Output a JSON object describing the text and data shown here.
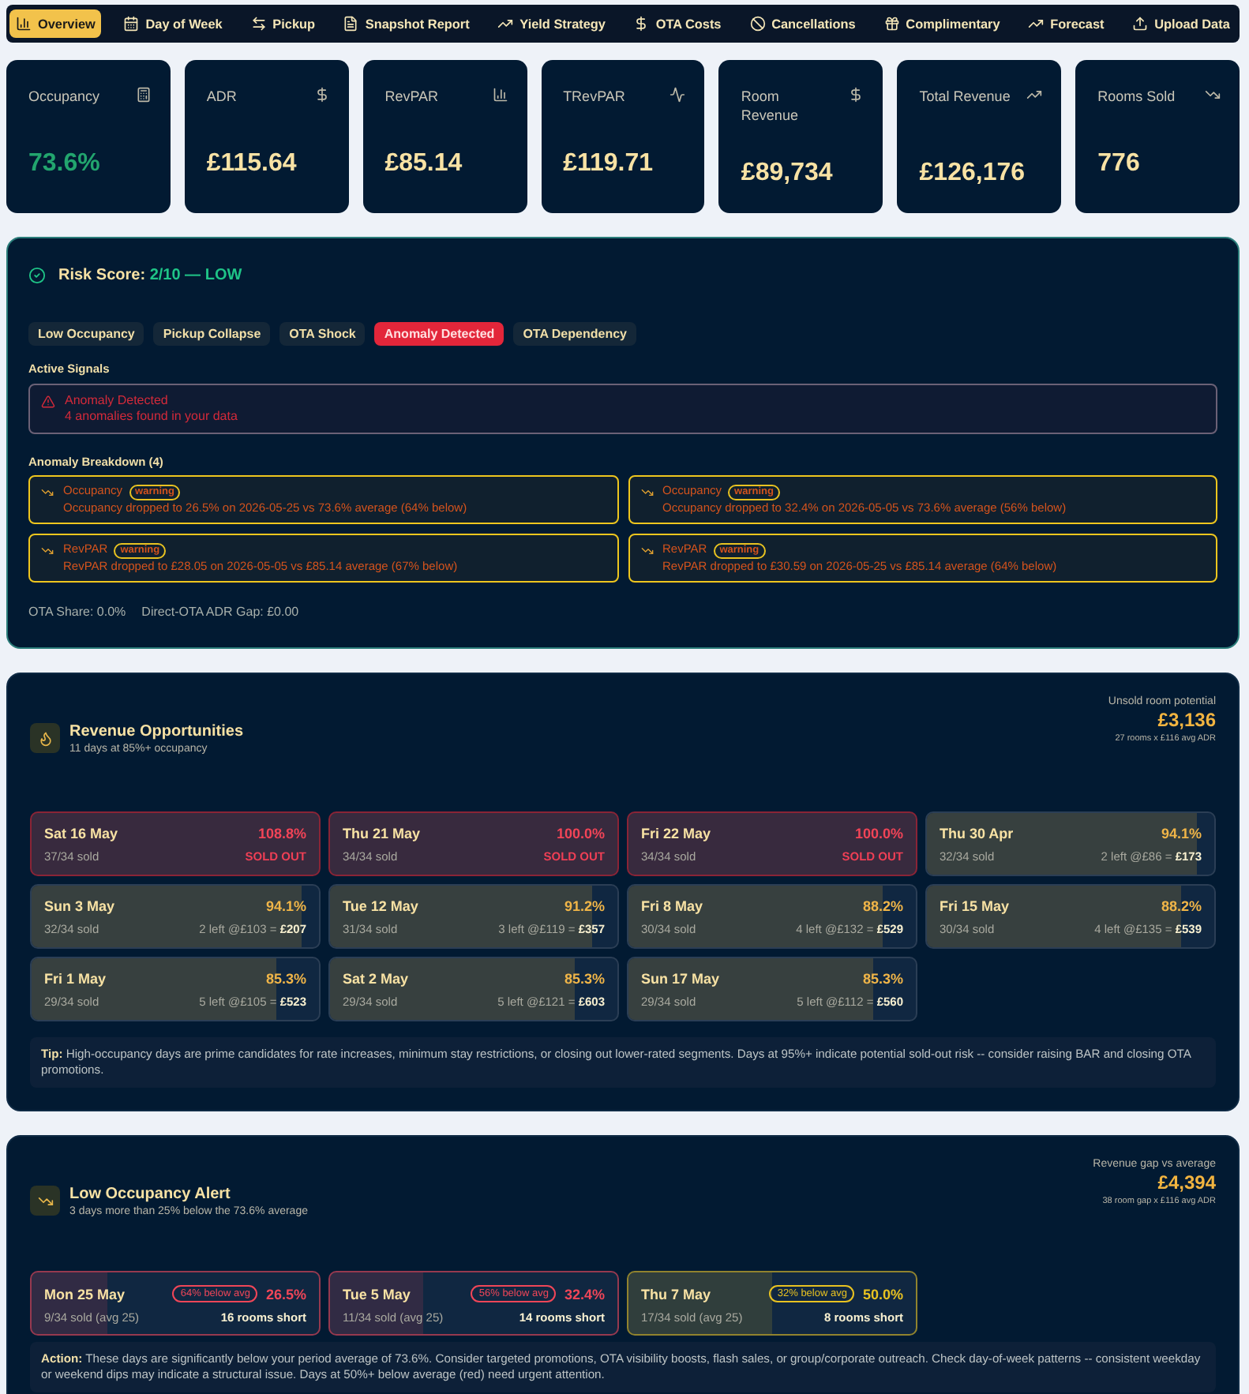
{
  "nav": [
    {
      "label": "Overview",
      "selected": true
    },
    {
      "label": "Day of Week",
      "selected": false
    },
    {
      "label": "Pickup",
      "selected": false
    },
    {
      "label": "Snapshot Report",
      "selected": false
    },
    {
      "label": "Yield Strategy",
      "selected": false
    },
    {
      "label": "OTA Costs",
      "selected": false
    },
    {
      "label": "Cancellations",
      "selected": false
    },
    {
      "label": "Complimentary",
      "selected": false
    },
    {
      "label": "Forecast",
      "selected": false
    },
    {
      "label": "Upload Data",
      "selected": false
    }
  ],
  "kpis": [
    {
      "label": "Occupancy",
      "value": "73.6%",
      "color": "#22a56e"
    },
    {
      "label": "ADR",
      "value": "£115.64",
      "color": "#f8e2a4"
    },
    {
      "label": "RevPAR",
      "value": "£85.14",
      "color": "#f8e2a4"
    },
    {
      "label": "TRevPAR",
      "value": "£119.71",
      "color": "#f8e2a4"
    },
    {
      "label": "Room Revenue",
      "value": "£89,734",
      "color": "#f8e2a4"
    },
    {
      "label": "Total Revenue",
      "value": "£126,176",
      "color": "#f8e2a4"
    },
    {
      "label": "Rooms Sold",
      "value": "776",
      "color": "#f8e2a4"
    }
  ],
  "risk": {
    "title": "Risk Score:",
    "score": "2/10 — LOW",
    "signals": [
      {
        "label": "Low Occupancy",
        "active": false
      },
      {
        "label": "Pickup Collapse",
        "active": false
      },
      {
        "label": "OTA Shock",
        "active": false
      },
      {
        "label": "Anomaly Detected",
        "active": true
      },
      {
        "label": "OTA Dependency",
        "active": false
      }
    ],
    "active_heading": "Active Signals",
    "alert": {
      "title": "Anomaly Detected",
      "message": "4 anomalies found in your data"
    },
    "breakdown_heading": "Anomaly Breakdown (4)",
    "anomalies": [
      {
        "metric": "Occupancy",
        "badge": "warning",
        "message": "Occupancy dropped to 26.5% on 2026-05-25 vs 73.6% average (64% below)"
      },
      {
        "metric": "Occupancy",
        "badge": "warning",
        "message": "Occupancy dropped to 32.4% on 2026-05-05 vs 73.6% average (56% below)"
      },
      {
        "metric": "RevPAR",
        "badge": "warning",
        "message": "RevPAR dropped to £28.05 on 2026-05-05 vs £85.14 average (67% below)"
      },
      {
        "metric": "RevPAR",
        "badge": "warning",
        "message": "RevPAR dropped to £30.59 on 2026-05-25 vs £85.14 average (64% below)"
      }
    ],
    "footer": [
      "OTA Share: 0.0%",
      "Direct-OTA ADR Gap: £0.00"
    ]
  },
  "opportunities": {
    "title": "Revenue Opportunities",
    "subtitle": "11 days at 85%+ occupancy",
    "potential_label": "Unsold room potential",
    "potential_value": "£3,136",
    "potential_note": "27 rooms x £116 avg ADR",
    "days": [
      {
        "date": "Sat 16 May",
        "pct": "108.8%",
        "sold": "37/34 sold",
        "kind": "sold_out",
        "note": "SOLD OUT"
      },
      {
        "date": "Thu 21 May",
        "pct": "100.0%",
        "sold": "34/34 sold",
        "kind": "sold_out",
        "note": "SOLD OUT"
      },
      {
        "date": "Fri 22 May",
        "pct": "100.0%",
        "sold": "34/34 sold",
        "kind": "sold_out",
        "note": "SOLD OUT"
      },
      {
        "date": "Thu 30 Apr",
        "pct": "94.1%",
        "sold": "32/34 sold",
        "kind": "open",
        "level": 0.941,
        "note": "2 left @£86 =",
        "amount": "£173"
      },
      {
        "date": "Sun 3 May",
        "pct": "94.1%",
        "sold": "32/34 sold",
        "kind": "open",
        "level": 0.941,
        "note": "2 left @£103 =",
        "amount": "£207"
      },
      {
        "date": "Tue 12 May",
        "pct": "91.2%",
        "sold": "31/34 sold",
        "kind": "open",
        "level": 0.912,
        "note": "3 left @£119 =",
        "amount": "£357"
      },
      {
        "date": "Fri 8 May",
        "pct": "88.2%",
        "sold": "30/34 sold",
        "kind": "open",
        "level": 0.882,
        "note": "4 left @£132 =",
        "amount": "£529"
      },
      {
        "date": "Fri 15 May",
        "pct": "88.2%",
        "sold": "30/34 sold",
        "kind": "open",
        "level": 0.882,
        "note": "4 left @£135 =",
        "amount": "£539"
      },
      {
        "date": "Fri 1 May",
        "pct": "85.3%",
        "sold": "29/34 sold",
        "kind": "open",
        "level": 0.853,
        "note": "5 left @£105 =",
        "amount": "£523"
      },
      {
        "date": "Sat 2 May",
        "pct": "85.3%",
        "sold": "29/34 sold",
        "kind": "open",
        "level": 0.853,
        "note": "5 left @£121 =",
        "amount": "£603"
      },
      {
        "date": "Sun 17 May",
        "pct": "85.3%",
        "sold": "29/34 sold",
        "kind": "open",
        "level": 0.853,
        "note": "5 left @£112 =",
        "amount": "£560"
      }
    ],
    "tip": "**Tip:** High-occupancy days are prime candidates for rate increases, minimum stay restrictions, or closing out lower-rated segments. Days at 95%+ indicate potential sold-out risk -- consider raising BAR and closing OTA promotions."
  },
  "low_occupancy": {
    "title": "Low Occupancy Alert",
    "subtitle": "3 days more than 25% below the 73.6% average",
    "gap_label": "Revenue gap vs average",
    "gap_value": "£4,394",
    "gap_note": "38 room gap x £116 avg ADR",
    "days": [
      {
        "date": "Mon 25 May",
        "badge": "64% below avg",
        "pct": "26.5%",
        "sold": "9/34 sold (avg 25)",
        "short": "16 rooms short",
        "color": "#f04658",
        "level": 0.265
      },
      {
        "date": "Tue 5 May",
        "badge": "56% below avg",
        "pct": "32.4%",
        "sold": "11/34 sold (avg 25)",
        "short": "14 rooms short",
        "color": "#f04658",
        "level": 0.324
      },
      {
        "date": "Thu 7 May",
        "badge": "32% below avg",
        "pct": "50.0%",
        "sold": "17/34 sold (avg 25)",
        "short": "8 rooms short",
        "color": "#e8c221",
        "level": 0.5
      }
    ],
    "action": "**Action:** These days are significantly below your period average of 73.6%. Consider targeted promotions, OTA visibility boosts, flash sales, or group/corporate outreach. Check day-of-week patterns -- consistent weekday or weekend dips may indicate a structural issue. Days at 50%+ below average (red) need urgent attention."
  }
}
